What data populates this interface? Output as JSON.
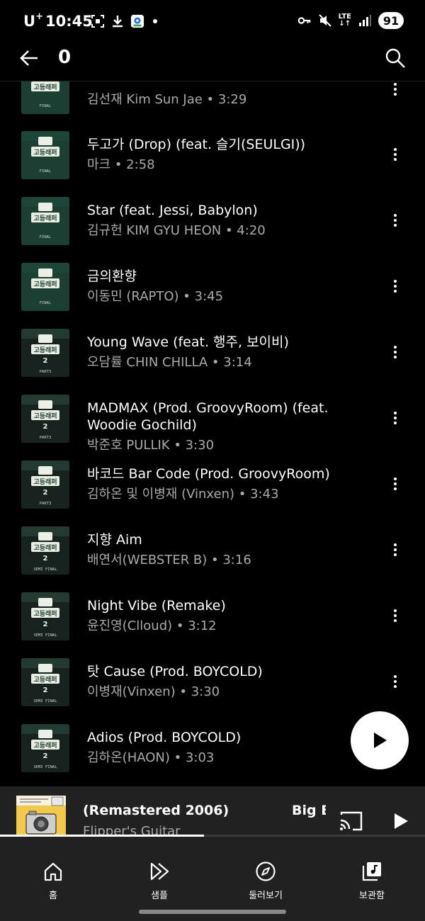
{
  "status_bar": {
    "carrier": "U",
    "carrier_sup": "+",
    "time": "10:45",
    "network": "LTE",
    "battery": "91",
    "icons_left": [
      "screenshot-icon",
      "download-icon",
      "maps-icon"
    ],
    "icons_right": [
      "vpn-key-icon",
      "mute-icon",
      "lte-icon",
      "signal-icon",
      "battery-icon"
    ]
  },
  "header": {
    "title": "0",
    "back_icon": "back-arrow-icon",
    "search_icon": "search-icon"
  },
  "tracks": [
    {
      "title": "",
      "subtitle": "김선재 Kim Sun Jae • 3:29",
      "art": "final"
    },
    {
      "title": "두고가 (Drop) (feat. 슬기(SEULGI))",
      "subtitle": "마크 • 2:58",
      "art": "final"
    },
    {
      "title": "Star (feat. Jessi, Babylon)",
      "subtitle": "김규헌 KIM GYU HEON • 4:20",
      "art": "final"
    },
    {
      "title": "금의환향",
      "subtitle": "이동민 (RAPTO) • 3:45",
      "art": "final"
    },
    {
      "title": "Young Wave (feat. 행주, 보이비)",
      "subtitle": "오담률 CHIN CHILLA • 3:14",
      "art": "part3"
    },
    {
      "title": "MADMAX (Prod. GroovyRoom) (feat. Woodie Gochild)",
      "subtitle": "박준호 PULLIK • 3:30",
      "art": "part3"
    },
    {
      "title": "바코드 Bar Code (Prod. GroovyRoom)",
      "subtitle": "김하온 및 이병재 (Vinxen) • 3:43",
      "art": "part3"
    },
    {
      "title": "지향 Aim",
      "subtitle": "배연서(WEBSTER B) • 3:16",
      "art": "semi"
    },
    {
      "title": "Night Vibe (Remake)",
      "subtitle": "윤진영(Clloud) • 3:12",
      "art": "semi"
    },
    {
      "title": "탓 Cause (Prod. BOYCOLD)",
      "subtitle": "이병재(Vinxen) • 3:30",
      "art": "semi"
    },
    {
      "title": "Adios (Prod. BOYCOLD)",
      "subtitle": "김하온(HAON) • 3:03",
      "art": "semi"
    }
  ],
  "album_art_labels": {
    "final": "FINAL",
    "part3": "PART3",
    "semi": "SEMI FINAL",
    "logo": "고등래퍼"
  },
  "mini_player": {
    "title": "(Remastered 2006)",
    "title_next": "Big B",
    "artist": "Flipper's Guitar",
    "progress_fraction": 0.48
  },
  "bottom_nav": [
    {
      "label": "홈",
      "icon": "home-icon"
    },
    {
      "label": "샘플",
      "icon": "samples-icon"
    },
    {
      "label": "둘러보기",
      "icon": "explore-icon"
    },
    {
      "label": "보관함",
      "icon": "library-icon"
    }
  ],
  "colors": {
    "background": "#000000",
    "secondary_text": "#aaaaaa",
    "player_bg": "#212121",
    "album_green": "#1b3f33"
  }
}
